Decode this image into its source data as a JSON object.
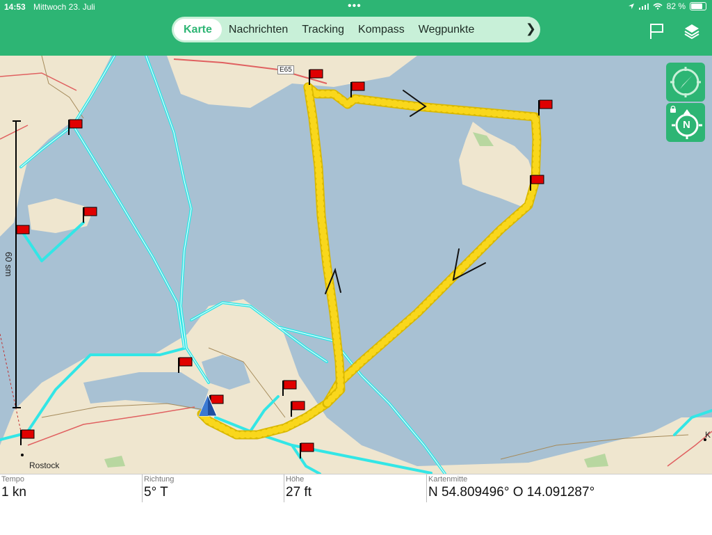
{
  "status": {
    "time": "14:53",
    "date": "Mittwoch 23. Juli",
    "battery": "82 %",
    "battery_level": 0.82
  },
  "tabs": [
    {
      "label": "Karte",
      "active": true
    },
    {
      "label": "Nachrichten",
      "active": false
    },
    {
      "label": "Tracking",
      "active": false
    },
    {
      "label": "Kompass",
      "active": false
    },
    {
      "label": "Wegpunkte",
      "active": false
    }
  ],
  "toolbar": {
    "flag_icon": "flag-icon",
    "layers_icon": "layers-icon"
  },
  "map": {
    "scale_label": "60 sm",
    "road_label": "E65",
    "place_rostock": "Rostock",
    "place_k": "K",
    "compass_letter": "N"
  },
  "info": {
    "tempo": {
      "label": "Tempo",
      "value": "1 kn"
    },
    "richtung": {
      "label": "Richtung",
      "value": "5° T"
    },
    "hoehe": {
      "label": "Höhe",
      "value": "27 ft"
    },
    "kartenmitte": {
      "label": "Kartenmitte",
      "value": "N 54.809496°  O 14.091287°"
    }
  },
  "colors": {
    "accent": "#2db574",
    "water": "#a8c1d3",
    "land": "#efe6cf",
    "route": "#33e6e6",
    "track": "#f9d71c",
    "flag": "#e00000"
  }
}
